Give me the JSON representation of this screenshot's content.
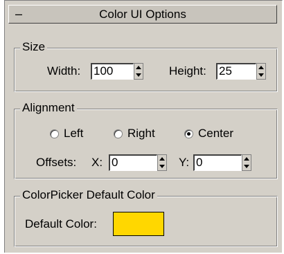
{
  "title": "Color UI Options",
  "size": {
    "legend": "Size",
    "width_label": "Width:",
    "width_value": "100",
    "height_label": "Height:",
    "height_value": "25"
  },
  "alignment": {
    "legend": "Alignment",
    "options": [
      "Left",
      "Right",
      "Center"
    ],
    "selected": "Center",
    "offsets_label": "Offsets:",
    "x_label": "X:",
    "x_value": "0",
    "y_label": "Y:",
    "y_value": "0"
  },
  "colorpicker": {
    "legend": "ColorPicker Default Color",
    "default_label": "Default Color:",
    "default_color": "#ffd700"
  },
  "icons": {
    "collapse": "minus-icon"
  }
}
